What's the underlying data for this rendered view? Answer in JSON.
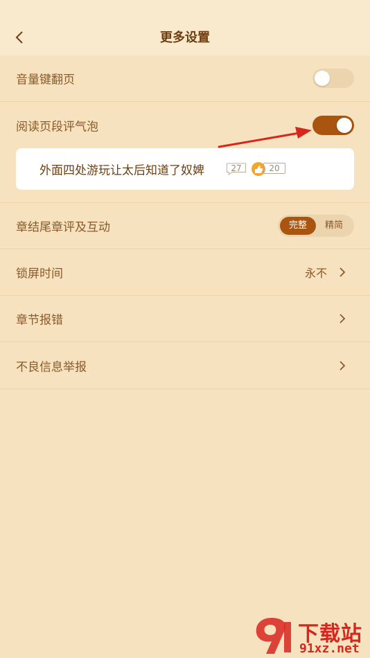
{
  "header": {
    "title": "更多设置"
  },
  "settings": {
    "volume_page": {
      "label": "音量键翻页",
      "enabled": false
    },
    "paragraph_bubble": {
      "label": "阅读页段评气泡",
      "enabled": true
    },
    "chapter_end": {
      "label": "章结尾章评及互动",
      "options": [
        "完整",
        "精简"
      ],
      "selected": "完整"
    },
    "lock_screen": {
      "label": "锁屏时间",
      "value": "永不"
    },
    "chapter_error": {
      "label": "章节报错"
    },
    "bad_info": {
      "label": "不良信息举报"
    }
  },
  "preview": {
    "text": "外面四处游玩让太后知道了奴婢",
    "comments": "27",
    "likes": "20"
  },
  "watermark": {
    "top": "下载站",
    "bottom": "91xz.net"
  },
  "colors": {
    "accent": "#a9550f",
    "background": "#f6e2bf",
    "header": "#f9e9cd",
    "arrow": "#d7261e"
  }
}
